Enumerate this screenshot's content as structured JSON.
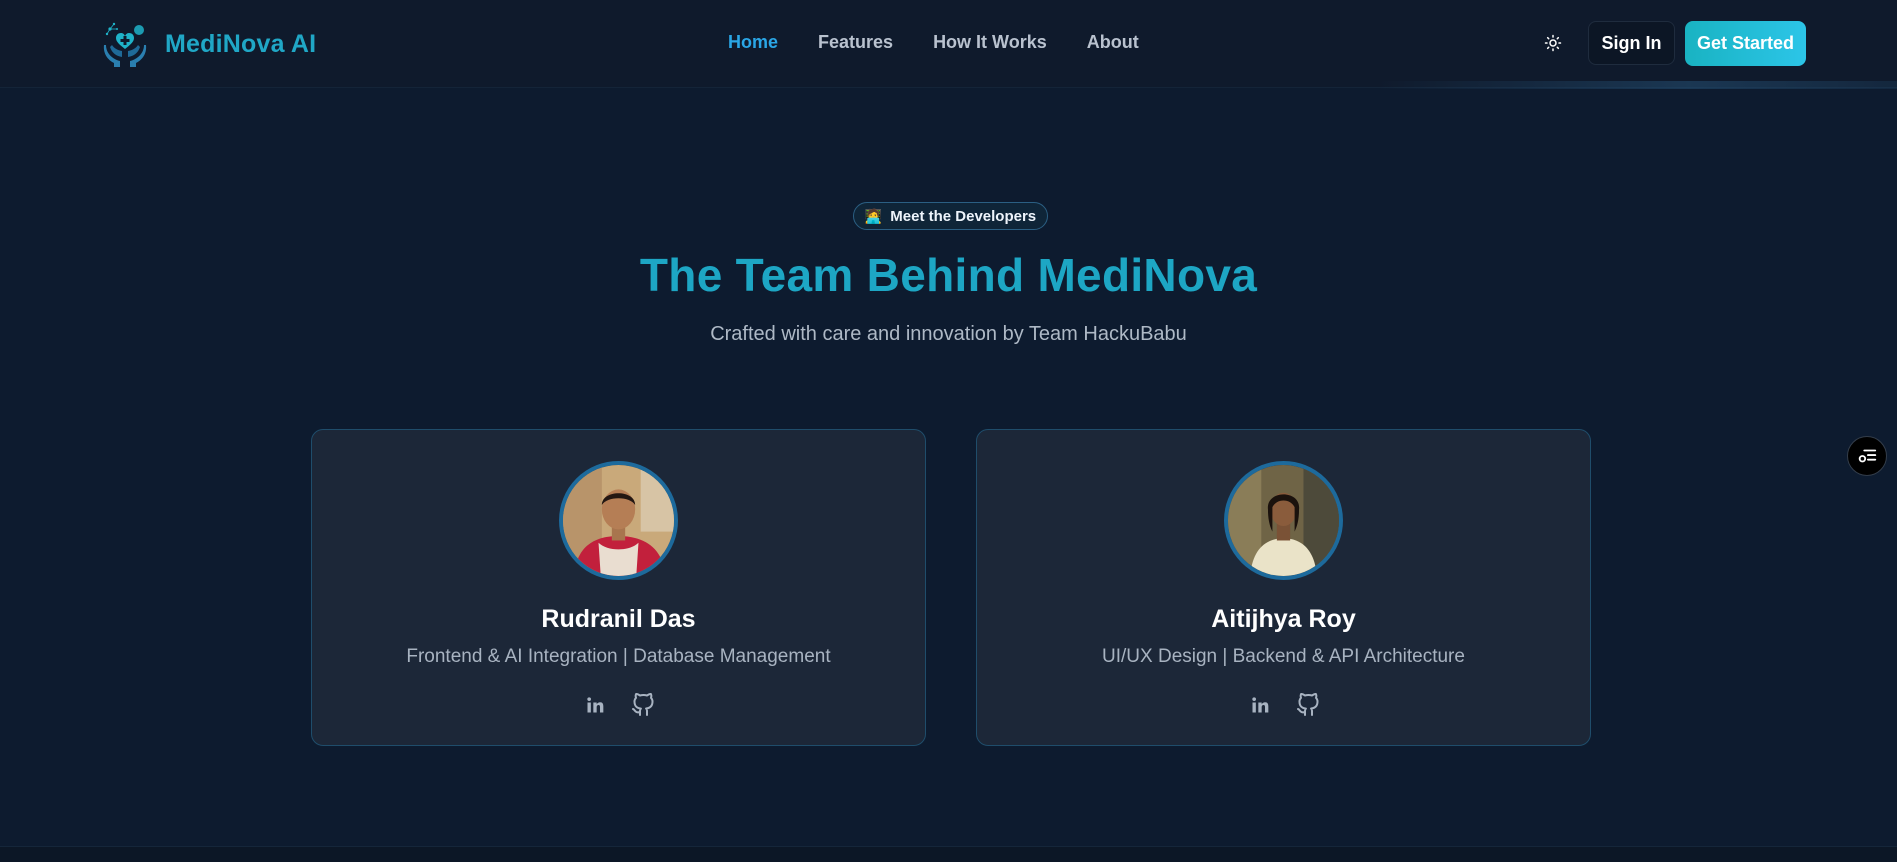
{
  "brand": {
    "name": "MediNova AI"
  },
  "nav": {
    "links": [
      {
        "label": "Home",
        "active": true
      },
      {
        "label": "Features",
        "active": false
      },
      {
        "label": "How It Works",
        "active": false
      },
      {
        "label": "About",
        "active": false
      }
    ],
    "signin_label": "Sign In",
    "cta_label": "Get Started"
  },
  "hero": {
    "badge_emoji": "🧑‍💻",
    "badge_text": "Meet the Developers",
    "title": "The Team Behind MediNova",
    "subtitle": "Crafted with care and innovation by Team HackuBabu"
  },
  "team": [
    {
      "name": "Rudranil Das",
      "role": "Frontend & AI Integration | Database Management"
    },
    {
      "name": "Aitijhya Roy",
      "role": "UI/UX Design | Backend & API Architecture"
    }
  ],
  "colors": {
    "background": "#0d1b2f",
    "accent": "#20a7c6",
    "active_nav": "#2aa6e6",
    "card": "#1c2738",
    "card_border": "#1f4d6b"
  },
  "icons": {
    "theme_toggle": "sun-icon",
    "social": [
      "linkedin-icon",
      "github-icon"
    ],
    "floating": "settings-list-icon"
  }
}
